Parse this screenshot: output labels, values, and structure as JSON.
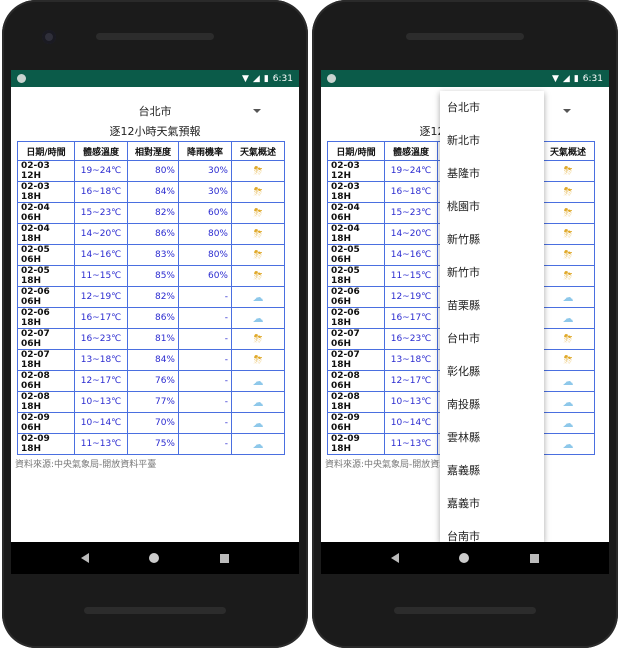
{
  "status": {
    "time": "6:31"
  },
  "city": "台北市",
  "subtitle": "逐12小時天氣預報",
  "table": {
    "headers": [
      "日期/時間",
      "體感溫度",
      "相對溼度",
      "降雨機率",
      "天氣概述"
    ],
    "rows": [
      {
        "datetime": "02-03 12H",
        "temp": "19~24℃",
        "humidity": "80%",
        "rain": "30%",
        "icon": "⛈"
      },
      {
        "datetime": "02-03 18H",
        "temp": "16~18℃",
        "humidity": "84%",
        "rain": "30%",
        "icon": "⛈"
      },
      {
        "datetime": "02-04 06H",
        "temp": "15~23℃",
        "humidity": "82%",
        "rain": "60%",
        "icon": "⛈"
      },
      {
        "datetime": "02-04 18H",
        "temp": "14~20℃",
        "humidity": "86%",
        "rain": "80%",
        "icon": "⛈"
      },
      {
        "datetime": "02-05 06H",
        "temp": "14~16℃",
        "humidity": "83%",
        "rain": "80%",
        "icon": "⛈"
      },
      {
        "datetime": "02-05 18H",
        "temp": "11~15℃",
        "humidity": "85%",
        "rain": "60%",
        "icon": "⛈"
      },
      {
        "datetime": "02-06 06H",
        "temp": "12~19℃",
        "humidity": "82%",
        "rain": "-",
        "icon": "☁"
      },
      {
        "datetime": "02-06 18H",
        "temp": "16~17℃",
        "humidity": "86%",
        "rain": "-",
        "icon": "☁"
      },
      {
        "datetime": "02-07 06H",
        "temp": "16~23℃",
        "humidity": "81%",
        "rain": "-",
        "icon": "⛈"
      },
      {
        "datetime": "02-07 18H",
        "temp": "13~18℃",
        "humidity": "84%",
        "rain": "-",
        "icon": "⛈"
      },
      {
        "datetime": "02-08 06H",
        "temp": "12~17℃",
        "humidity": "76%",
        "rain": "-",
        "icon": "☁"
      },
      {
        "datetime": "02-08 18H",
        "temp": "10~13℃",
        "humidity": "77%",
        "rain": "-",
        "icon": "☁"
      },
      {
        "datetime": "02-09 06H",
        "temp": "10~14℃",
        "humidity": "70%",
        "rain": "-",
        "icon": "☁"
      },
      {
        "datetime": "02-09 18H",
        "temp": "11~13℃",
        "humidity": "75%",
        "rain": "-",
        "icon": "☁"
      }
    ]
  },
  "source": "資料來源:中央氣象局-開放資料平臺",
  "dropdown": [
    "台北市",
    "新北市",
    "基隆市",
    "桃園市",
    "新竹縣",
    "新竹市",
    "苗栗縣",
    "台中市",
    "彰化縣",
    "南投縣",
    "雲林縣",
    "嘉義縣",
    "嘉義市",
    "台南市"
  ],
  "colors": {
    "statusbar": "#0b5b49",
    "table_border": "#4a6fe0",
    "value_text": "#2b2bd0"
  }
}
